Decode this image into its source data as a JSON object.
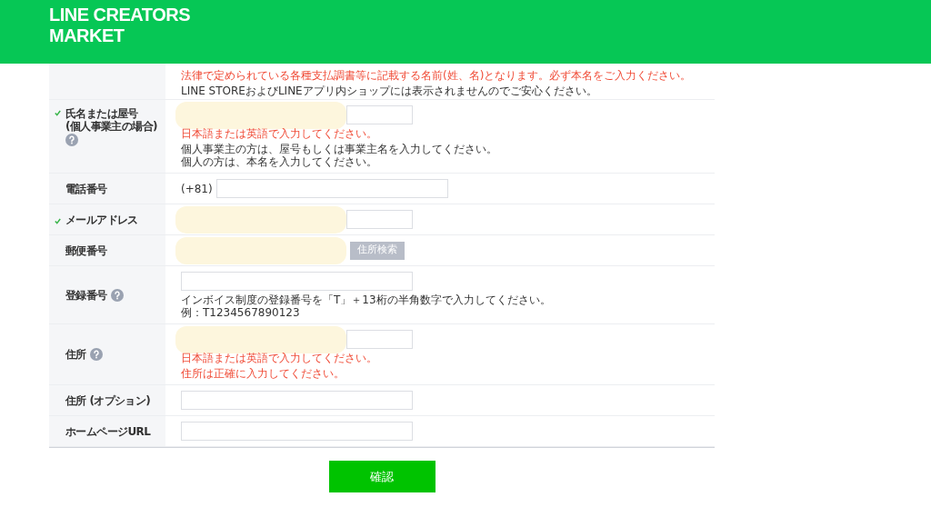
{
  "header": {
    "logo_lines": [
      "LINE CREATORS",
      "MARKET"
    ]
  },
  "intro": {
    "notes": [
      {
        "text": "法律で定められている各種支払調書等に記載する名前(姓、名)となります。必ず本名をご入力ください。",
        "kind": "error"
      },
      {
        "text": "LINE STOREおよびLINEアプリ内ショップには表示されませんのでご安心ください。",
        "kind": "info"
      }
    ]
  },
  "rows": [
    {
      "label_lines": [
        "氏名または屋号",
        "(個人事業主の場合)"
      ],
      "verified": true,
      "help": true,
      "value": "",
      "redacted": true,
      "notes": [
        {
          "text": "日本語または英語で入力してください。",
          "kind": "error"
        },
        {
          "text": "個人事業主の方は、屋号もしくは事業主名を入力してください。",
          "kind": "info"
        },
        {
          "text": "個人の方は、本名を入力してください。",
          "kind": "info"
        }
      ]
    },
    {
      "label_lines": [
        "電話番号"
      ],
      "verified": false,
      "help": false,
      "prefix": "(+81)",
      "value": "",
      "redacted": false,
      "notes": []
    },
    {
      "label_lines": [
        "メールアドレス"
      ],
      "verified": true,
      "help": false,
      "value": "",
      "redacted": true,
      "notes": []
    },
    {
      "label_lines": [
        "郵便番号"
      ],
      "verified": false,
      "help": false,
      "value": "",
      "redacted": true,
      "button": {
        "label": "住所検索",
        "disabled": true
      },
      "notes": []
    },
    {
      "label_lines": [
        "登録番号"
      ],
      "verified": false,
      "help": true,
      "value": "",
      "redacted": false,
      "notes": [
        {
          "text": "インボイス制度の登録番号を「T」＋13桁の半角数字で入力してください。",
          "kind": "info"
        },
        {
          "text": "例：T1234567890123",
          "kind": "info"
        }
      ]
    },
    {
      "label_lines": [
        "住所"
      ],
      "verified": false,
      "help": true,
      "value": "",
      "redacted": true,
      "notes": [
        {
          "text": "日本語または英語で入力してください。",
          "kind": "error"
        },
        {
          "text": "住所は正確に入力してください。",
          "kind": "error"
        }
      ]
    },
    {
      "label_lines": [
        "住所 (オプション)"
      ],
      "verified": false,
      "help": false,
      "value": "",
      "redacted": false,
      "notes": []
    },
    {
      "label_lines": [
        "ホームページURL"
      ],
      "verified": false,
      "help": false,
      "value": "",
      "redacted": false,
      "notes": []
    }
  ],
  "confirm_button": {
    "label": "確認",
    "disabled": false
  }
}
